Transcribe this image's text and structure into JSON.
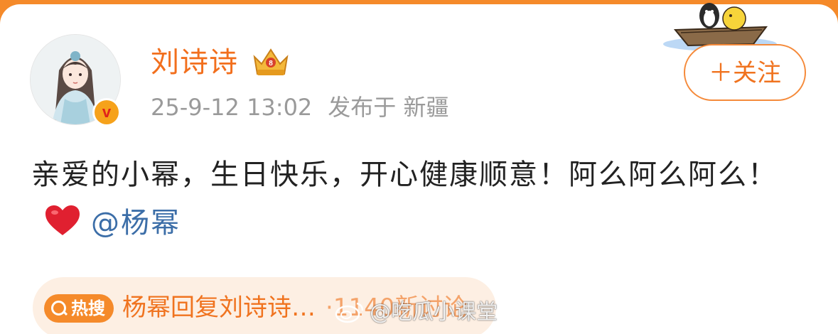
{
  "user": {
    "name": "刘诗诗",
    "crown_badge_icon": "gold-crown-member-badge-icon",
    "verified_icon": "yellow-v-verified-badge-icon",
    "verified_letter": "v"
  },
  "post": {
    "timestamp": "25-9-12 13:02",
    "location": "发布于 新疆",
    "text_before_heart": "亲爱的小幂，生日快乐，开心健康顺意！阿么阿么阿么！",
    "heart_icon": "red-heart-emoji",
    "mention": "@杨幂"
  },
  "follow_button": {
    "label": "＋关注"
  },
  "hot_search": {
    "badge_label": "热搜",
    "title": "杨幂回复刘诗诗…",
    "count": "·1140新讨论"
  },
  "watermark": {
    "text": "@吃瓜小课堂"
  },
  "colors": {
    "accent_orange": "#f26f1d",
    "mention_blue": "#3c6ea8",
    "heart_red": "#e02030",
    "meta_gray": "#9a9a9a"
  }
}
